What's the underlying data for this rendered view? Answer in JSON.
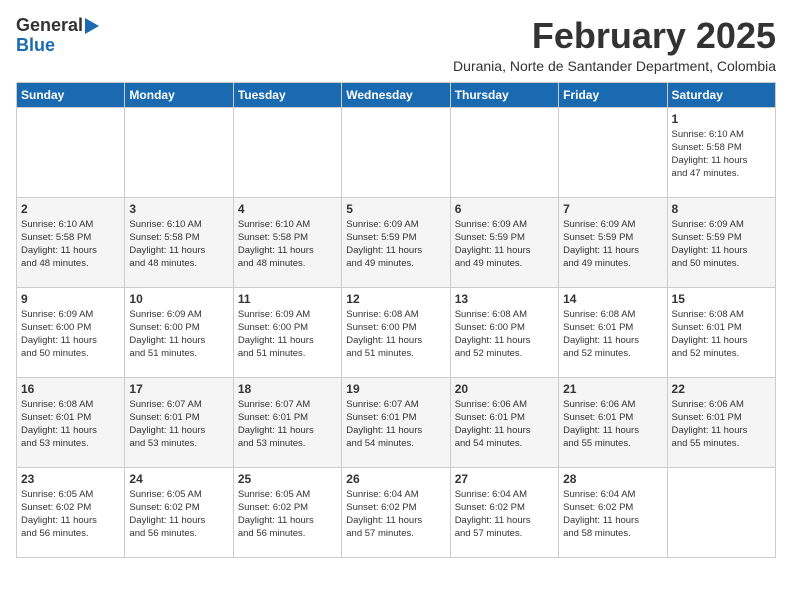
{
  "header": {
    "logo_line1": "General",
    "logo_line2": "Blue",
    "month_year": "February 2025",
    "location": "Durania, Norte de Santander Department, Colombia"
  },
  "weekdays": [
    "Sunday",
    "Monday",
    "Tuesday",
    "Wednesday",
    "Thursday",
    "Friday",
    "Saturday"
  ],
  "weeks": [
    [
      {
        "day": "",
        "info": ""
      },
      {
        "day": "",
        "info": ""
      },
      {
        "day": "",
        "info": ""
      },
      {
        "day": "",
        "info": ""
      },
      {
        "day": "",
        "info": ""
      },
      {
        "day": "",
        "info": ""
      },
      {
        "day": "1",
        "info": "Sunrise: 6:10 AM\nSunset: 5:58 PM\nDaylight: 11 hours\nand 47 minutes."
      }
    ],
    [
      {
        "day": "2",
        "info": "Sunrise: 6:10 AM\nSunset: 5:58 PM\nDaylight: 11 hours\nand 48 minutes."
      },
      {
        "day": "3",
        "info": "Sunrise: 6:10 AM\nSunset: 5:58 PM\nDaylight: 11 hours\nand 48 minutes."
      },
      {
        "day": "4",
        "info": "Sunrise: 6:10 AM\nSunset: 5:58 PM\nDaylight: 11 hours\nand 48 minutes."
      },
      {
        "day": "5",
        "info": "Sunrise: 6:09 AM\nSunset: 5:59 PM\nDaylight: 11 hours\nand 49 minutes."
      },
      {
        "day": "6",
        "info": "Sunrise: 6:09 AM\nSunset: 5:59 PM\nDaylight: 11 hours\nand 49 minutes."
      },
      {
        "day": "7",
        "info": "Sunrise: 6:09 AM\nSunset: 5:59 PM\nDaylight: 11 hours\nand 49 minutes."
      },
      {
        "day": "8",
        "info": "Sunrise: 6:09 AM\nSunset: 5:59 PM\nDaylight: 11 hours\nand 50 minutes."
      }
    ],
    [
      {
        "day": "9",
        "info": "Sunrise: 6:09 AM\nSunset: 6:00 PM\nDaylight: 11 hours\nand 50 minutes."
      },
      {
        "day": "10",
        "info": "Sunrise: 6:09 AM\nSunset: 6:00 PM\nDaylight: 11 hours\nand 51 minutes."
      },
      {
        "day": "11",
        "info": "Sunrise: 6:09 AM\nSunset: 6:00 PM\nDaylight: 11 hours\nand 51 minutes."
      },
      {
        "day": "12",
        "info": "Sunrise: 6:08 AM\nSunset: 6:00 PM\nDaylight: 11 hours\nand 51 minutes."
      },
      {
        "day": "13",
        "info": "Sunrise: 6:08 AM\nSunset: 6:00 PM\nDaylight: 11 hours\nand 52 minutes."
      },
      {
        "day": "14",
        "info": "Sunrise: 6:08 AM\nSunset: 6:01 PM\nDaylight: 11 hours\nand 52 minutes."
      },
      {
        "day": "15",
        "info": "Sunrise: 6:08 AM\nSunset: 6:01 PM\nDaylight: 11 hours\nand 52 minutes."
      }
    ],
    [
      {
        "day": "16",
        "info": "Sunrise: 6:08 AM\nSunset: 6:01 PM\nDaylight: 11 hours\nand 53 minutes."
      },
      {
        "day": "17",
        "info": "Sunrise: 6:07 AM\nSunset: 6:01 PM\nDaylight: 11 hours\nand 53 minutes."
      },
      {
        "day": "18",
        "info": "Sunrise: 6:07 AM\nSunset: 6:01 PM\nDaylight: 11 hours\nand 53 minutes."
      },
      {
        "day": "19",
        "info": "Sunrise: 6:07 AM\nSunset: 6:01 PM\nDaylight: 11 hours\nand 54 minutes."
      },
      {
        "day": "20",
        "info": "Sunrise: 6:06 AM\nSunset: 6:01 PM\nDaylight: 11 hours\nand 54 minutes."
      },
      {
        "day": "21",
        "info": "Sunrise: 6:06 AM\nSunset: 6:01 PM\nDaylight: 11 hours\nand 55 minutes."
      },
      {
        "day": "22",
        "info": "Sunrise: 6:06 AM\nSunset: 6:01 PM\nDaylight: 11 hours\nand 55 minutes."
      }
    ],
    [
      {
        "day": "23",
        "info": "Sunrise: 6:05 AM\nSunset: 6:02 PM\nDaylight: 11 hours\nand 56 minutes."
      },
      {
        "day": "24",
        "info": "Sunrise: 6:05 AM\nSunset: 6:02 PM\nDaylight: 11 hours\nand 56 minutes."
      },
      {
        "day": "25",
        "info": "Sunrise: 6:05 AM\nSunset: 6:02 PM\nDaylight: 11 hours\nand 56 minutes."
      },
      {
        "day": "26",
        "info": "Sunrise: 6:04 AM\nSunset: 6:02 PM\nDaylight: 11 hours\nand 57 minutes."
      },
      {
        "day": "27",
        "info": "Sunrise: 6:04 AM\nSunset: 6:02 PM\nDaylight: 11 hours\nand 57 minutes."
      },
      {
        "day": "28",
        "info": "Sunrise: 6:04 AM\nSunset: 6:02 PM\nDaylight: 11 hours\nand 58 minutes."
      },
      {
        "day": "",
        "info": ""
      }
    ]
  ]
}
